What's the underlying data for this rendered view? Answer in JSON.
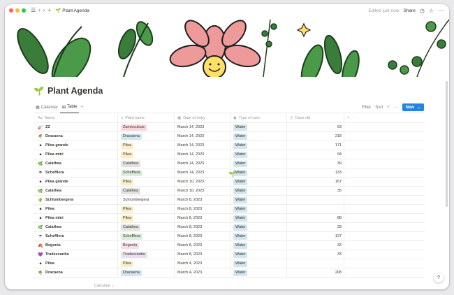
{
  "titlebar": {
    "page_name": "Plant Agenda",
    "edited": "Edited just now",
    "share": "Share"
  },
  "page": {
    "title": "Plant Agenda",
    "title_icon": "sprout-icon"
  },
  "views": {
    "tabs": [
      {
        "label": "Calendar",
        "icon": "calendar-icon"
      },
      {
        "label": "Table",
        "icon": "table-icon"
      }
    ],
    "filter": "Filter",
    "sort": "Sort",
    "new": "New"
  },
  "columns": [
    {
      "label": "Name",
      "icon": "Aa"
    },
    {
      "label": "Plant name",
      "icon": "list-icon"
    },
    {
      "label": "Date of entry",
      "icon": "calendar-icon"
    },
    {
      "label": "Type of care",
      "icon": "tag-icon"
    },
    {
      "label": "Days old",
      "icon": "clock-icon"
    }
  ],
  "rows": [
    {
      "emoji": "🎸",
      "name": "ZZ",
      "plant": "Zamioculcas",
      "tag_color": "#f8d7da",
      "date": "March 14, 2023",
      "care": "Water",
      "days": "63"
    },
    {
      "emoji": "🌴",
      "name": "Dracaena",
      "plant": "Dracaena",
      "tag_color": "#d3e5ef",
      "date": "March 14, 2023",
      "care": "Water",
      "days": "218"
    },
    {
      "emoji": "⚫",
      "name": "Pilea grande",
      "plant": "Pilea",
      "tag_color": "#fdecc8",
      "date": "March 14, 2023",
      "care": "Water",
      "days": "171"
    },
    {
      "emoji": "⚫",
      "name": "Pilea mini",
      "plant": "Pilea",
      "tag_color": "#fdecc8",
      "date": "March 14, 2023",
      "care": "Water",
      "days": "94"
    },
    {
      "emoji": "🌿",
      "name": "Calathea",
      "plant": "Calathea",
      "tag_color": "#e3e2e0",
      "date": "March 14, 2023",
      "care": "Water",
      "days": "39"
    },
    {
      "emoji": "☂",
      "name": "Schefflera",
      "plant": "Schefflera",
      "tag_color": "#dbeddb",
      "date": "March 14, 2023",
      "care": "Water",
      "days": "133"
    },
    {
      "emoji": "⚫",
      "name": "Pilea grande",
      "plant": "Pilea",
      "tag_color": "#fdecc8",
      "date": "March 10, 2023",
      "care": "Water",
      "days": "167"
    },
    {
      "emoji": "🌿",
      "name": "Calathea",
      "plant": "Calathea",
      "tag_color": "#e3e2e0",
      "date": "March 10, 2023",
      "care": "Water",
      "days": "35"
    },
    {
      "emoji": "🌵",
      "name": "Schlumbergera",
      "plant": "Schlumbergera",
      "tag_color": "#ffffff",
      "date": "March 8, 2023",
      "care": "Water",
      "days": ""
    },
    {
      "emoji": "⚫",
      "name": "Pilea",
      "plant": "Pilea",
      "tag_color": "#fdecc8",
      "date": "March 8, 2023",
      "care": "Water",
      "days": ""
    },
    {
      "emoji": "⚫",
      "name": "Pilea mini",
      "plant": "Pilea",
      "tag_color": "#fdecc8",
      "date": "March 8, 2023",
      "care": "Water",
      "days": "88"
    },
    {
      "emoji": "🌿",
      "name": "Calathea",
      "plant": "Calathea",
      "tag_color": "#e3e2e0",
      "date": "March 8, 2023",
      "care": "Water",
      "days": "33"
    },
    {
      "emoji": "☂",
      "name": "Schefflera",
      "plant": "Schefflera",
      "tag_color": "#dbeddb",
      "date": "March 8, 2023",
      "care": "Water",
      "days": "127"
    },
    {
      "emoji": "🍂",
      "name": "Begonia",
      "plant": "Begonia",
      "tag_color": "#f5e0e9",
      "date": "March 8, 2023",
      "care": "Water",
      "days": "33"
    },
    {
      "emoji": "💜",
      "name": "Tradescantia",
      "plant": "Tradescantia",
      "tag_color": "#e8deee",
      "date": "March 8, 2023",
      "care": "Water",
      "days": "33"
    },
    {
      "emoji": "⚫",
      "name": "Pilea",
      "plant": "Pilea",
      "tag_color": "#fdecc8",
      "date": "March 4, 2023",
      "care": "Water",
      "days": ""
    },
    {
      "emoji": "🌴",
      "name": "Dracaena",
      "plant": "Dracaena",
      "tag_color": "#d3e5ef",
      "date": "March 4, 2023",
      "care": "Water",
      "days": "208"
    }
  ],
  "footer": {
    "calculate": "Calculate ⌄"
  },
  "help": "?"
}
